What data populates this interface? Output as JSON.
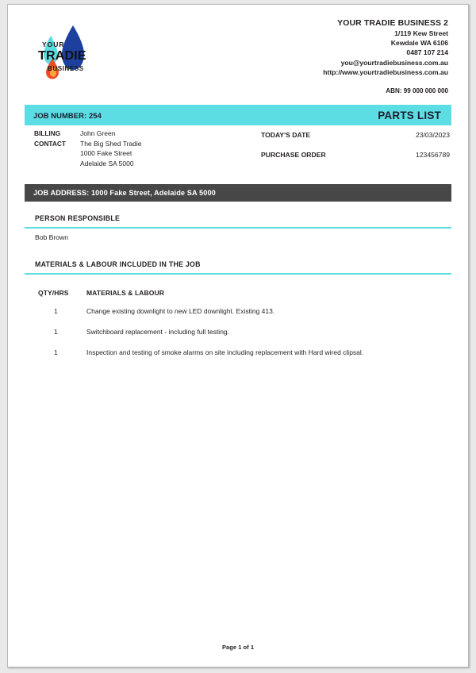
{
  "company": {
    "logo_text_top": "YOUR",
    "logo_text_mid": "TRADIE",
    "logo_text_bottom": "BUSINESS",
    "name": "YOUR TRADIE BUSINESS 2",
    "address_line1": "1/119 Kew Street",
    "address_line2": "Kewdale WA 6106",
    "phone": "0487 107 214",
    "email": "you@yourtradiebusiness.com.au",
    "website": "http://www.yourtradiebusiness.com.au",
    "abn": "ABN: 99 000 000 000"
  },
  "job_bar": {
    "job_number": "JOB NUMBER: 254",
    "document_title": "PARTS LIST"
  },
  "billing": {
    "label_line1": "BILLING",
    "label_line2": "CONTACT",
    "contact_name": "John Green",
    "business": "The Big Shed Tradie",
    "street": "1000 Fake Street",
    "city_state_post": "Adelaide SA 5000"
  },
  "meta": {
    "date_label": "TODAY'S DATE",
    "date_value": "23/03/2023",
    "po_label": "PURCHASE ORDER",
    "po_value": "123456789"
  },
  "job_address": {
    "text": "JOB ADDRESS: 1000 Fake Street, Adelaide SA 5000"
  },
  "person_responsible": {
    "heading": "PERSON RESPONSIBLE",
    "name": "Bob Brown"
  },
  "materials": {
    "heading": "MATERIALS & LABOUR INCLUDED IN THE JOB",
    "col_qty": "QTY/HRS",
    "col_desc": "MATERIALS & LABOUR",
    "rows": [
      {
        "qty": "1",
        "desc": "Change existing downlight to new LED downlight. Existing 413."
      },
      {
        "qty": "1",
        "desc": "Switchboard replacement - including full testing."
      },
      {
        "qty": "1",
        "desc": "Inspection and testing of smoke alarms on site including replacement with Hard wired clipsal."
      }
    ]
  },
  "footer": {
    "page_text": "Page 1 of 1"
  },
  "colors": {
    "accent_cyan": "#5cdce3",
    "bar_dark": "#474747",
    "logo_blue": "#1d3f9e",
    "logo_cyan": "#5cdce3",
    "logo_orange": "#ef4a23",
    "text": "#231f20"
  }
}
